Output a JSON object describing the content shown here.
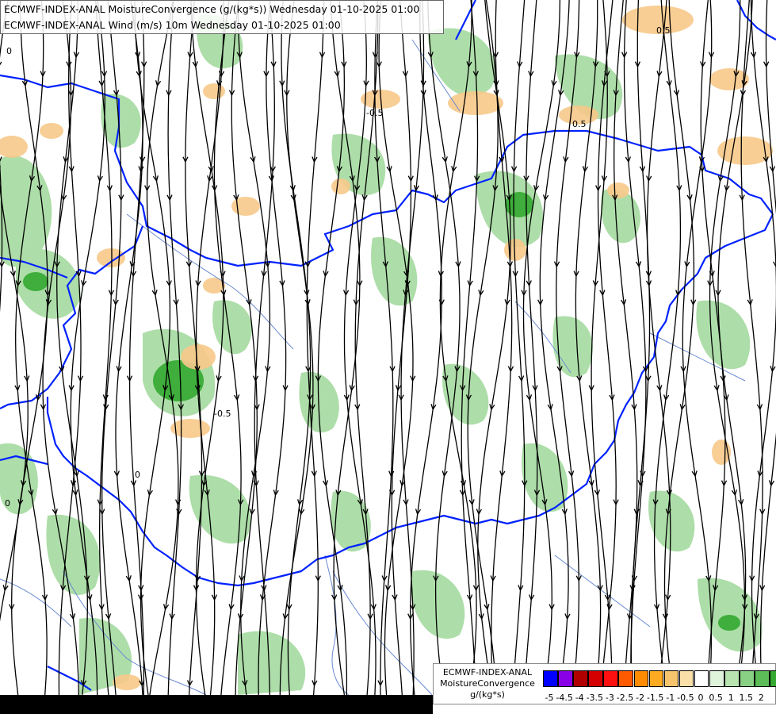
{
  "titles": {
    "line1": "ECMWF-INDEX-ANAL MoistureConvergence (g/(kg*s)) Wednesday 01-10-2025 01:00",
    "line2": "ECMWF-INDEX-ANAL Wind (m/s) 10m Wednesday 01-10-2025 01:00"
  },
  "legend": {
    "model": "ECMWF-INDEX-ANAL",
    "parameter": "MoistureConvergence",
    "unit": "g/(kg*s)",
    "colors": [
      "#0000ff",
      "#8a00e6",
      "#b00000",
      "#d40000",
      "#ff1010",
      "#ff5a00",
      "#ff8c00",
      "#ffaa20",
      "#f5c46c",
      "#fae0a8",
      "#ffffff",
      "#e0f4dc",
      "#b8e4b0",
      "#8ad084",
      "#5cbc58",
      "#34a830",
      "#0c9a0c"
    ],
    "tick_labels": [
      "-5",
      "-4.5",
      "-4",
      "-3.5",
      "-3",
      "-2.5",
      "-2",
      "-1.5",
      "-1",
      "-0.5",
      "0",
      "0.5",
      "1",
      "1.5",
      "2"
    ]
  },
  "map_labels": [
    "0",
    "-0.5",
    "0.5",
    "-0.5",
    "0",
    "0.5",
    "0"
  ],
  "colors": {
    "border": "#0022ff",
    "river": "#6a8ad0",
    "streamline": "#000000",
    "convergence_green": "#9fd89a",
    "divergence_orange": "#f7c98a"
  }
}
